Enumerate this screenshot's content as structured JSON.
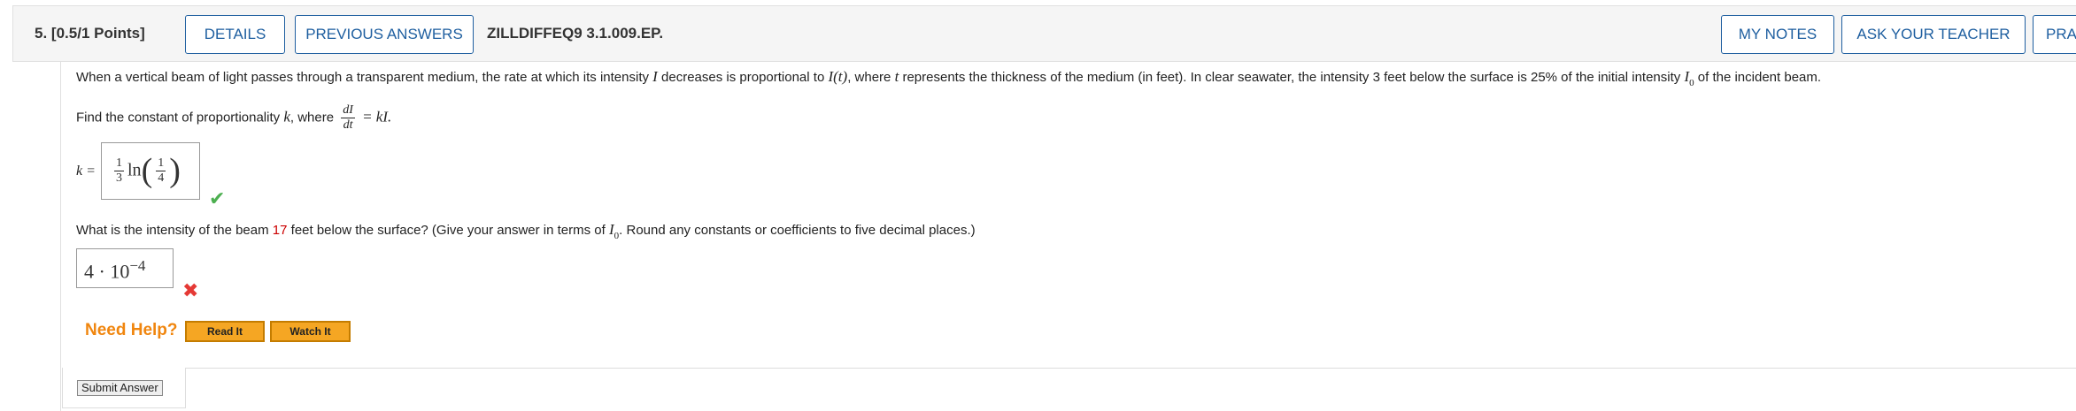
{
  "header": {
    "question_number": "5.",
    "points": "[0.5/1 Points]",
    "details_label": "DETAILS",
    "previous_answers_label": "PREVIOUS ANSWERS",
    "question_id": "ZILLDIFFEQ9 3.1.009.EP.",
    "my_notes_label": "MY NOTES",
    "ask_teacher_label": "ASK YOUR TEACHER",
    "practice_label": "PRA"
  },
  "problem": {
    "text_1": "When a vertical beam of light passes through a transparent medium, the rate at which its intensity",
    "var_I": "I",
    "text_2": "decreases is proportional to",
    "I_of_t": "I(t)",
    "text_3": ", where",
    "var_t": "t",
    "text_4": "represents the thickness of the medium (in feet). In clear seawater, the intensity 3 feet below the surface is 25% of the initial intensity",
    "I0_base": "I",
    "I0_sub": "0",
    "text_5": "of the incident beam."
  },
  "part_a": {
    "prompt_1": "Find the constant of proportionality",
    "var_k": "k",
    "prompt_2": ", where",
    "deriv_num": "dI",
    "deriv_den": "dt",
    "rhs": "= kI.",
    "k_label": "k =",
    "answer_coef_num": "1",
    "answer_coef_den": "3",
    "answer_ln": "ln",
    "answer_arg_num": "1",
    "answer_arg_den": "4",
    "status": "correct"
  },
  "part_b": {
    "prompt_1": "What is the intensity of the beam",
    "depth": "17",
    "prompt_2": "feet below the surface? (Give your answer in terms of",
    "I0_base": "I",
    "I0_sub": "0",
    "prompt_3": ". Round any constants or coefficients to five decimal places.)",
    "answer_base": "4 · 10",
    "answer_exp": "−4",
    "status": "incorrect"
  },
  "help": {
    "label": "Need Help?",
    "read_it": "Read It",
    "watch_it": "Watch It"
  },
  "submit_label": "Submit Answer",
  "colors": {
    "accent": "#1f5fa0",
    "help_orange": "#f0860f",
    "correct_green": "#4caf50",
    "incorrect_red": "#e53935"
  }
}
